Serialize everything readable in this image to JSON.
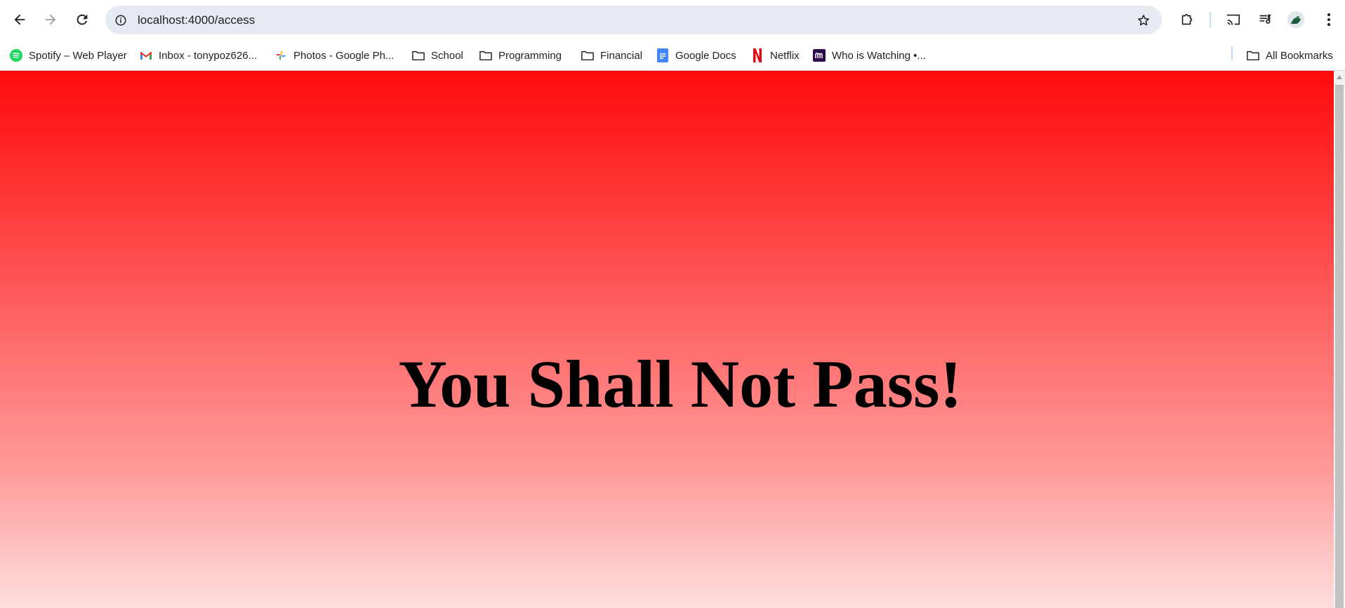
{
  "browser": {
    "url": "localhost:4000/access",
    "bookmarks": [
      {
        "label": "Spotify – Web Player",
        "icon": "spotify-icon"
      },
      {
        "label": "Inbox - tonypoz626...",
        "icon": "gmail-icon"
      },
      {
        "label": "Photos - Google Ph...",
        "icon": "google-photos-icon"
      },
      {
        "label": "School",
        "icon": "folder-icon"
      },
      {
        "label": "Programming",
        "icon": "folder-icon"
      },
      {
        "label": "Financial",
        "icon": "folder-icon"
      },
      {
        "label": "Google Docs",
        "icon": "google-docs-icon"
      },
      {
        "label": "Netflix",
        "icon": "netflix-icon"
      },
      {
        "label": "Who is Watching •...",
        "icon": "m-icon"
      }
    ],
    "all_bookmarks_label": "All Bookmarks"
  },
  "page": {
    "headline": "You Shall Not Pass!",
    "colors": {
      "gradient_top": "#ff0a0a",
      "gradient_bottom": "#ffdede"
    }
  }
}
